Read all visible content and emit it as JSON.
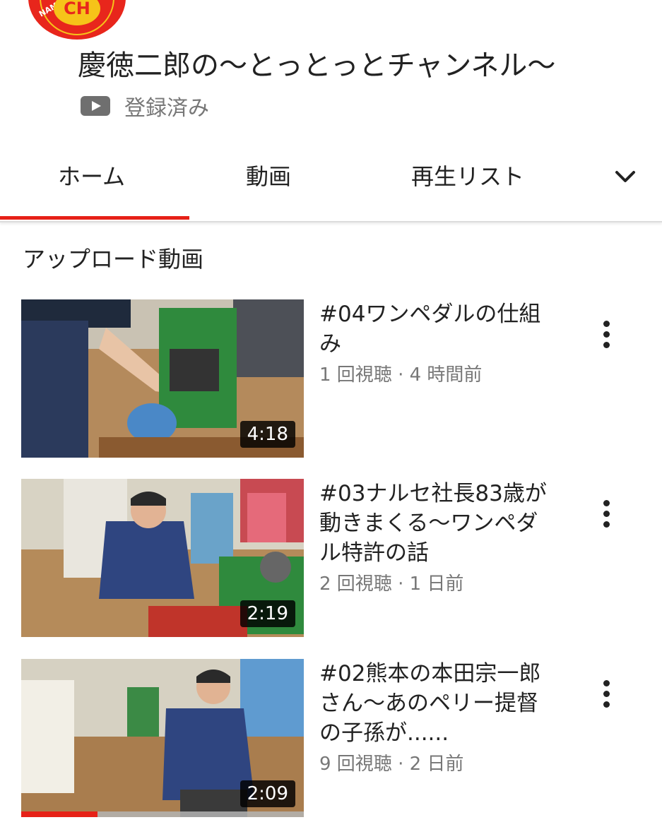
{
  "channel": {
    "title": "慶徳二郎の〜とっとっとチャンネル〜",
    "subscribed_label": "登録済み",
    "logo_text": "CH",
    "logo_ring_text": "NAME KIKAKU P"
  },
  "tabs": [
    {
      "label": "ホーム",
      "active": true
    },
    {
      "label": "動画",
      "active": false
    },
    {
      "label": "再生リスト",
      "active": false
    }
  ],
  "section": {
    "title": "アップロード動画"
  },
  "videos": [
    {
      "title": "#04ワンペダルの仕組み",
      "meta": "1 回視聴 · 4 時間前",
      "duration": "4:18",
      "watched_fraction": 0
    },
    {
      "title": "#03ナルセ社長83歳が動きまくる〜ワンペダル特許の話",
      "meta": "2 回視聴 · 1 日前",
      "duration": "2:19",
      "watched_fraction": 0
    },
    {
      "title": "#02熊本の本田宗一郎さん〜あのペリー提督の子孫が......",
      "meta": "9 回視聴 · 2 日前",
      "duration": "2:09",
      "watched_fraction": 0.27
    }
  ],
  "colors": {
    "accent": "#e62117",
    "text": "#222222",
    "secondary": "#777777"
  },
  "icons": {
    "subscribed": "youtube-play-icon",
    "more_tabs": "chevron-down-icon",
    "video_menu": "more-vert-icon"
  }
}
